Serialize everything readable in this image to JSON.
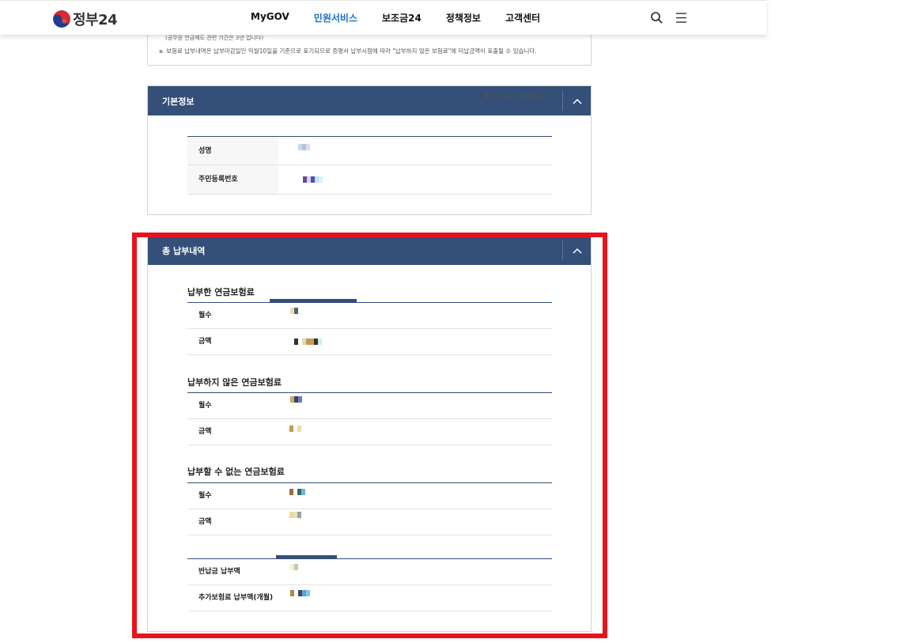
{
  "header": {
    "logo_text": "정부24",
    "nav": [
      "MyGOV",
      "민원서비스",
      "보조금24",
      "정책정보",
      "고객센터"
    ],
    "active_nav": "민원서비스",
    "search_icon": "search-icon",
    "menu_icon": "hamburger-menu-icon"
  },
  "notice": {
    "line1": "(공무원 연금제도 관련 기간은 3년 입니다)",
    "line2": "보험료 납부내역은 납부마감일인 익월10일을 기준으로 표기되므로 증명서 납부시점에 따라 \"납부하지 않은 보험료\"에 미납금액이 표출될 수 있습니다."
  },
  "basic_info": {
    "title": "기본정보",
    "required_note": "표시는 필수 입력사항입니다.",
    "rows": [
      {
        "label": "성명"
      },
      {
        "label": "주민등록번호"
      }
    ]
  },
  "total": {
    "title": "총 납부내역",
    "paid": {
      "heading": "납부한 연금보험료",
      "rows": [
        {
          "label": "월수"
        },
        {
          "label": "금액"
        }
      ]
    },
    "unpaid": {
      "heading": "납부하지 않은 연금보험료",
      "rows": [
        {
          "label": "월수"
        },
        {
          "label": "금액"
        }
      ]
    },
    "exempt": {
      "heading": "납부할 수 없는 연금보험료",
      "rows": [
        {
          "label": "월수"
        },
        {
          "label": "금액"
        }
      ]
    },
    "extra": {
      "rows": [
        {
          "label": "반납금 납부액"
        },
        {
          "label": "추가보험료 납부액(개월)"
        }
      ]
    }
  },
  "colors": {
    "header_bar": "#344f78",
    "active_nav": "#1b6fd1",
    "highlight": "#e8141c"
  }
}
